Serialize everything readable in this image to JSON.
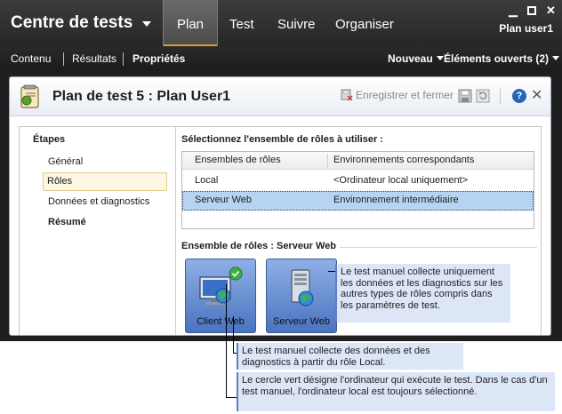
{
  "app": {
    "title": "Centre de tests",
    "nav_tabs": [
      "Plan",
      "Test",
      "Suivre",
      "Organiser"
    ],
    "active_tab": "Plan",
    "user": "Plan user1",
    "window_controls": [
      "minimize-icon",
      "maximize-icon",
      "close-icon"
    ]
  },
  "subnav": {
    "items": [
      "Contenu",
      "Résultats",
      "Propriétés"
    ],
    "active": "Propriétés",
    "new_label": "Nouveau",
    "open_items_label": "Éléments ouverts (2)"
  },
  "workitem": {
    "title": "Plan de test 5 : Plan User1",
    "save_close_label": "Enregistrer et fermer",
    "help_glyph": "?",
    "close_glyph": "✕"
  },
  "steps": {
    "title": "Étapes",
    "items": [
      "Général",
      "Rôles",
      "Données et diagnostics",
      "Résumé"
    ],
    "selected": "Rôles",
    "bold": "Résumé"
  },
  "roles": {
    "prompt": "Sélectionnez l'ensemble de rôles à utiliser :",
    "columns": [
      "Ensembles de rôles",
      "Environnements correspondants"
    ],
    "rows": [
      {
        "set": "Local",
        "env": "<Ordinateur local uniquement>"
      },
      {
        "set": "Serveur Web",
        "env": "Environnement intermédiaire"
      }
    ],
    "selected_row": 1,
    "role_set_label": "Ensemble de rôles :  Serveur Web",
    "tiles": [
      "Client Web",
      "Serveur Web"
    ]
  },
  "callouts": {
    "right": "Le test manuel collecte uniquement les données et les diagnostics sur les autres types de rôles compris dans les paramètres de test.",
    "bottom1": "Le test manuel collecte des données et des diagnostics à partir du rôle Local.",
    "bottom2": "Le cercle vert désigne l'ordinateur qui exécute le test. Dans le cas d'un test manuel, l'ordinateur local est toujours sélectionné."
  },
  "colors": {
    "chrome_dark": "#262626",
    "active_tab_accent": "#d79b2c",
    "selection": "#b6d4f1",
    "callout_bg": "#dde6f7",
    "callout_bar": "#5d7fbf",
    "tile_blue": "#4a73c0",
    "local_marker": "#3cb043"
  }
}
